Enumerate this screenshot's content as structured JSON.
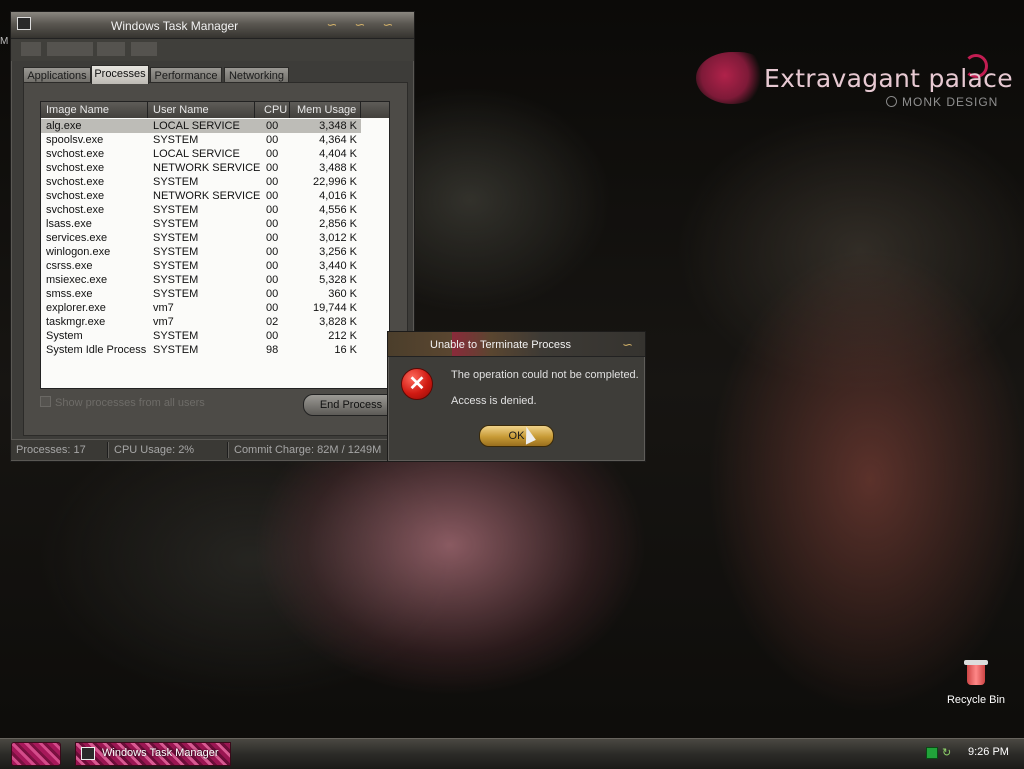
{
  "wallpaper": {
    "brand_title": "Extravagant palace",
    "brand_sub": "MONK DESIGN",
    "desktop_edge_text": "M"
  },
  "task_manager": {
    "title": "Windows Task Manager",
    "tabs": [
      {
        "label": "Applications"
      },
      {
        "label": "Processes",
        "active": true
      },
      {
        "label": "Performance"
      },
      {
        "label": "Networking"
      }
    ],
    "columns": {
      "image": "Image Name",
      "user": "User Name",
      "cpu": "CPU",
      "mem": "Mem Usage"
    },
    "processes": [
      {
        "image": "alg.exe",
        "user": "LOCAL SERVICE",
        "cpu": "00",
        "mem": "3,348 K",
        "selected": true
      },
      {
        "image": "spoolsv.exe",
        "user": "SYSTEM",
        "cpu": "00",
        "mem": "4,364 K"
      },
      {
        "image": "svchost.exe",
        "user": "LOCAL SERVICE",
        "cpu": "00",
        "mem": "4,404 K"
      },
      {
        "image": "svchost.exe",
        "user": "NETWORK SERVICE",
        "cpu": "00",
        "mem": "3,488 K"
      },
      {
        "image": "svchost.exe",
        "user": "SYSTEM",
        "cpu": "00",
        "mem": "22,996 K"
      },
      {
        "image": "svchost.exe",
        "user": "NETWORK SERVICE",
        "cpu": "00",
        "mem": "4,016 K"
      },
      {
        "image": "svchost.exe",
        "user": "SYSTEM",
        "cpu": "00",
        "mem": "4,556 K"
      },
      {
        "image": "lsass.exe",
        "user": "SYSTEM",
        "cpu": "00",
        "mem": "2,856 K"
      },
      {
        "image": "services.exe",
        "user": "SYSTEM",
        "cpu": "00",
        "mem": "3,012 K"
      },
      {
        "image": "winlogon.exe",
        "user": "SYSTEM",
        "cpu": "00",
        "mem": "3,256 K"
      },
      {
        "image": "csrss.exe",
        "user": "SYSTEM",
        "cpu": "00",
        "mem": "3,440 K"
      },
      {
        "image": "msiexec.exe",
        "user": "SYSTEM",
        "cpu": "00",
        "mem": "5,328 K"
      },
      {
        "image": "smss.exe",
        "user": "SYSTEM",
        "cpu": "00",
        "mem": "360 K"
      },
      {
        "image": "explorer.exe",
        "user": "vm7",
        "cpu": "00",
        "mem": "19,744 K"
      },
      {
        "image": "taskmgr.exe",
        "user": "vm7",
        "cpu": "02",
        "mem": "3,828 K"
      },
      {
        "image": "System",
        "user": "SYSTEM",
        "cpu": "00",
        "mem": "212 K"
      },
      {
        "image": "System Idle Process",
        "user": "SYSTEM",
        "cpu": "98",
        "mem": "16 K"
      }
    ],
    "show_all_label": "Show processes from all users",
    "end_process_label": "End Process",
    "status": {
      "processes": "Processes: 17",
      "cpu": "CPU Usage: 2%",
      "commit": "Commit Charge: 82M / 1249M"
    }
  },
  "dialog": {
    "title": "Unable to Terminate Process",
    "message_line1": "The operation could not be completed.",
    "message_line2": "Access is denied.",
    "ok_label": "OK",
    "icon": "error-icon"
  },
  "desktop": {
    "recycle_bin_label": "Recycle Bin"
  },
  "taskbar": {
    "task_label": "Windows Task Manager",
    "clock": "9:26 PM"
  }
}
